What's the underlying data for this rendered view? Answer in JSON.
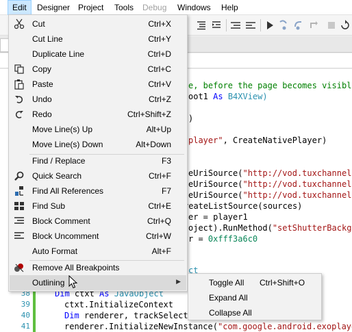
{
  "menubar": {
    "items": [
      {
        "label": "Edit"
      },
      {
        "label": "Designer"
      },
      {
        "label": "Project"
      },
      {
        "label": "Tools"
      },
      {
        "label": "Debug"
      },
      {
        "label": "Windows"
      },
      {
        "label": "Help"
      }
    ]
  },
  "editor": {
    "line_numbers": [
      "38",
      "39",
      "40",
      "41"
    ],
    "lines": {
      "l1a": "e, before the page becomes visible",
      "l2a": "oot1 ",
      "l2b": "As ",
      "l2c": "B4XView)",
      "l3a": ")",
      "l4a": "player\"",
      "l4b": ", CreateNativePlayer)",
      "l5a": "eUriSource(",
      "l5b": "\"http://vod.tuxchannel.t",
      "l6a": "eUriSource(",
      "l6b": "\"http://vod.tuxchannel.t",
      "l7a": "eUriSource(",
      "l7b": "\"http://vod.tuxchannel.t",
      "l8a": "reateListSource(sources)",
      "l9a": "er = player1",
      "l10a": "oject).RunMethod(",
      "l10b": "\"setShutterBackgro",
      "l11a": "r = ",
      "l11b": "0xfff3a6c0",
      "l12a": "ct",
      "l13a": "Dim ",
      "l13b": "ctxt ",
      "l13c": "As ",
      "l13d": "JavaObject",
      "l14a": "ctxt.InitializeContext",
      "l15a": "Dim ",
      "l15b": "renderer, trackSelect",
      "l16a": "renderer.InitializeNewInstance(",
      "l16b": "\"com.google.android.exoplayer"
    }
  },
  "edit_menu": {
    "items": [
      {
        "label": "Cut",
        "shortcut": "Ctrl+X",
        "icon": "scissors-icon"
      },
      {
        "label": "Cut Line",
        "shortcut": "Ctrl+Y"
      },
      {
        "label": "Duplicate Line",
        "shortcut": "Ctrl+D"
      },
      {
        "label": "Copy",
        "shortcut": "Ctrl+C",
        "icon": "copy-icon"
      },
      {
        "label": "Paste",
        "shortcut": "Ctrl+V",
        "icon": "paste-icon"
      },
      {
        "label": "Undo",
        "shortcut": "Ctrl+Z",
        "icon": "undo-icon"
      },
      {
        "label": "Redo",
        "shortcut": "Ctrl+Shift+Z",
        "icon": "redo-icon"
      },
      {
        "label": "Move Line(s) Up",
        "shortcut": "Alt+Up"
      },
      {
        "label": "Move Line(s) Down",
        "shortcut": "Alt+Down"
      },
      {
        "label": "Find / Replace",
        "shortcut": "F3"
      },
      {
        "label": "Quick Search",
        "shortcut": "Ctrl+F",
        "icon": "search-icon"
      },
      {
        "label": "Find All References",
        "shortcut": "F7",
        "icon": "references-icon"
      },
      {
        "label": "Find Sub",
        "shortcut": "Ctrl+E",
        "icon": "find-sub-icon"
      },
      {
        "label": "Block Comment",
        "shortcut": "Ctrl+Q",
        "icon": "comment-icon"
      },
      {
        "label": "Block Uncomment",
        "shortcut": "Ctrl+W",
        "icon": "uncomment-icon"
      },
      {
        "label": "Auto Format",
        "shortcut": "Alt+F"
      },
      {
        "label": "Remove All Breakpoints",
        "shortcut": "",
        "icon": "breakpoints-icon"
      },
      {
        "label": "Outlining",
        "shortcut": ""
      }
    ]
  },
  "outlining_submenu": {
    "items": [
      {
        "label": "Toggle All",
        "shortcut": "Ctrl+Shift+O"
      },
      {
        "label": "Expand All",
        "shortcut": ""
      },
      {
        "label": "Collapse All",
        "shortcut": ""
      }
    ]
  },
  "colors": {
    "menu_bg": "#f2f2f2",
    "menu_highlight": "#dadada",
    "menubar_active": "#cce8ff",
    "keyword": "#0000ff",
    "type": "#2b91af",
    "string": "#a31515",
    "change_bar": "#5fbf3f"
  }
}
